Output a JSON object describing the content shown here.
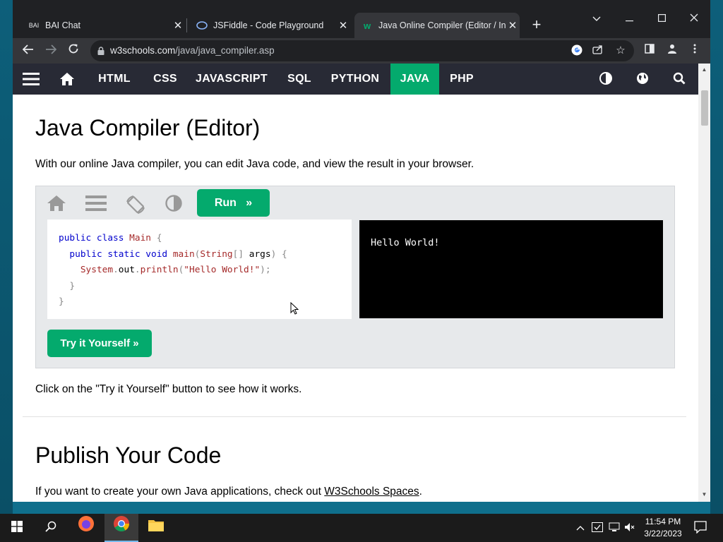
{
  "browser": {
    "tabs": [
      {
        "title": "BAI Chat",
        "favicon": "BAI",
        "close": "✕"
      },
      {
        "title": "JSFiddle - Code Playground",
        "favicon": "jsfiddle-icon",
        "close": "✕"
      },
      {
        "title": "Java Online Compiler (Editor / In",
        "favicon": "w3schools-icon",
        "close": "✕",
        "active": true
      }
    ],
    "new_tab": "+",
    "url_host": "w3schools.com",
    "url_path": "/java/java_compiler.asp"
  },
  "w3nav": {
    "items": [
      "HTML",
      "CSS",
      "JAVASCRIPT",
      "SQL",
      "PYTHON",
      "JAVA",
      "PHP"
    ],
    "active": "JAVA"
  },
  "page": {
    "title": "Java Compiler (Editor)",
    "intro": "With our online Java compiler, you can edit Java code, and view the result in your browser.",
    "run_label": "Run",
    "run_arrow": "»",
    "code": {
      "line1_kw": "public class",
      "line1_cls": "Main",
      "line1_br": "{",
      "line2_kw": "public static void",
      "line2_fn": "main",
      "line2_br1": "(",
      "line2_type": "String",
      "line2_arr": "[]",
      "line2_arg": "args",
      "line2_br2": ") {",
      "line3_obj": "System",
      "line3_dot1": ".",
      "line3_out": "out",
      "line3_dot2": ".",
      "line3_fn": "println",
      "line3_p1": "(",
      "line3_str": "\"Hello World!\"",
      "line3_p2": ");",
      "line4": "}",
      "line5": "}"
    },
    "output": "Hello World!",
    "try_label": "Try it Yourself »",
    "note": "Click on the \"Try it Yourself\" button to see how it works.",
    "publish_title": "Publish Your Code",
    "publish_text_before": "If you want to create your own Java applications, check out ",
    "publish_link": "W3Schools Spaces",
    "publish_text_after": "."
  },
  "taskbar": {
    "time": "11:54 PM",
    "date": "3/22/2023"
  },
  "colors": {
    "accent": "#04aa6d",
    "nav_bg": "#282a35",
    "demo_bg": "#e7e9eb"
  }
}
